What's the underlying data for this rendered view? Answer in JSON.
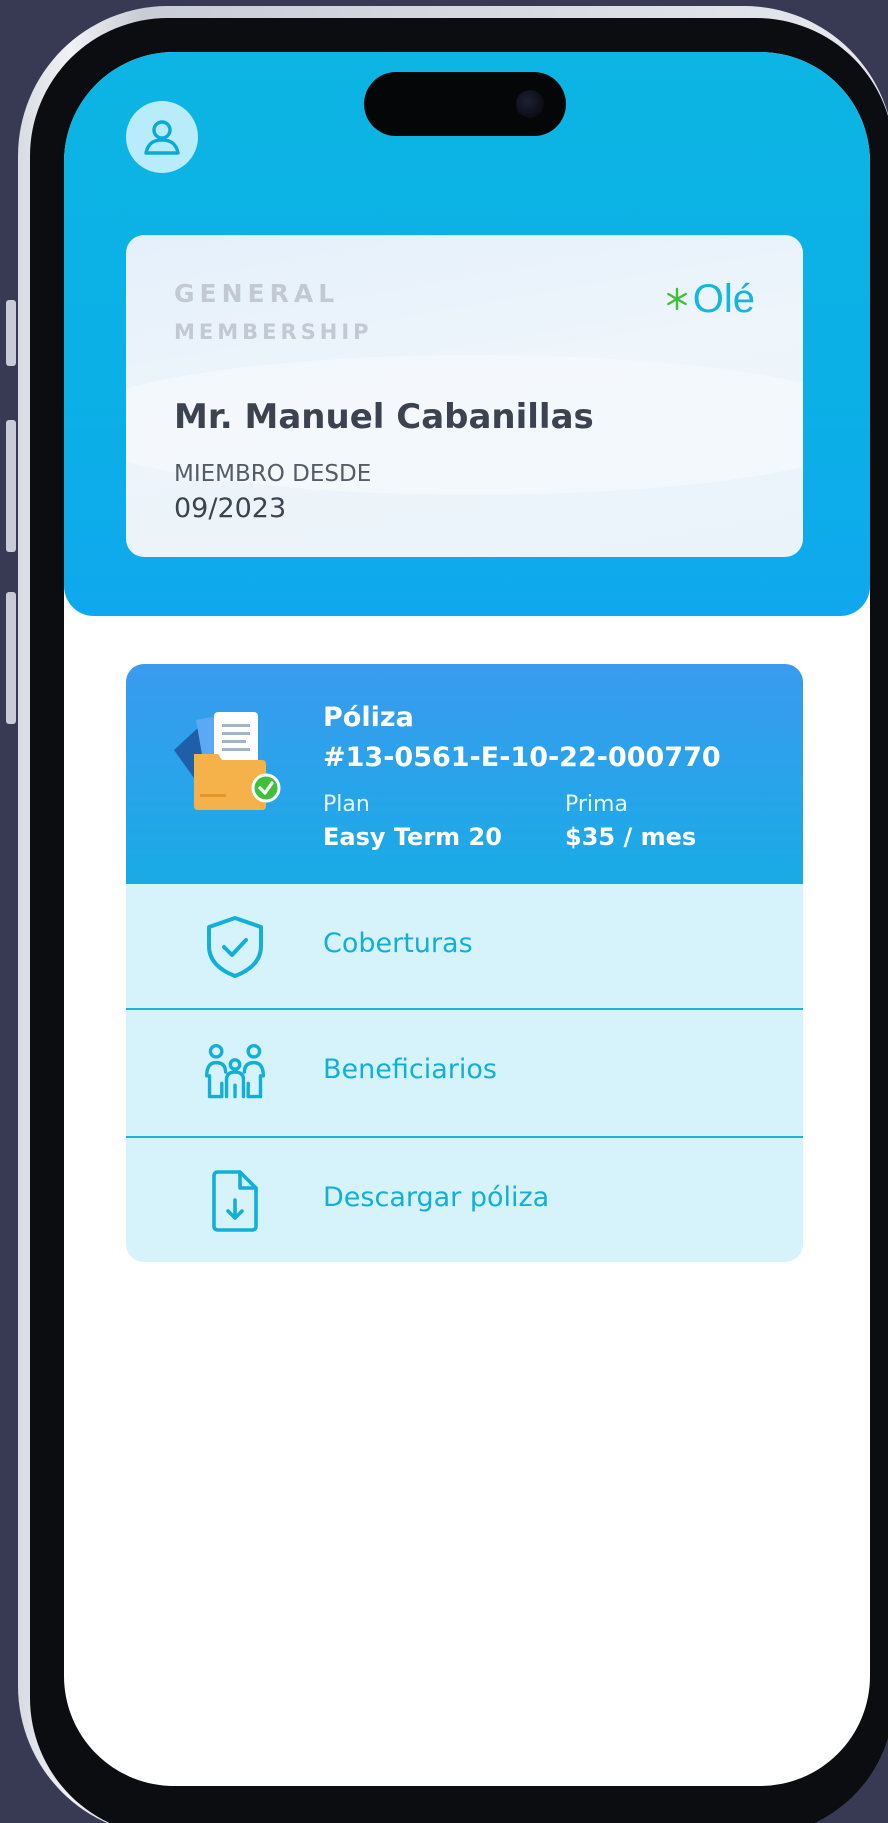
{
  "header": {
    "avatar_icon": "user-avatar-icon"
  },
  "membership": {
    "tier_line1": "GENERAL",
    "tier_line2": "MEMBERSHIP",
    "brand": "Olé",
    "brand_icon": "asterisk-logo-icon",
    "name": "Mr. Manuel Cabanillas",
    "since_label": "MIEMBRO DESDE",
    "since_date": "09/2023"
  },
  "policy": {
    "title": "Póliza",
    "number": "#13-0561-E-10-22-000770",
    "plan_label": "Plan",
    "plan_value": "Easy Term 20",
    "premium_label": "Prima",
    "premium_value": "$35 / mes",
    "illustration_icon": "policy-folder-icon"
  },
  "menu": {
    "items": [
      {
        "label": "Coberturas",
        "icon": "shield-check-icon"
      },
      {
        "label": "Beneficiarios",
        "icon": "family-icon"
      },
      {
        "label": "Descargar póliza",
        "icon": "file-download-icon"
      }
    ]
  },
  "colors": {
    "header_blue": "#0cb5e4",
    "policy_blue": "#3a9bef",
    "accent_cyan": "#12afd6",
    "menu_bg": "#d6f3fc",
    "frame_bg": "#373a52"
  }
}
